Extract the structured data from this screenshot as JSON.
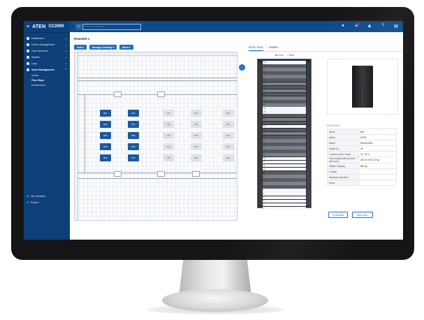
{
  "app": {
    "logo": "ATEN",
    "model": "CC2000",
    "search_placeholder": "Search Functions"
  },
  "sidebar": {
    "items": [
      {
        "label": "Dashboard",
        "icon": "grid-icon",
        "chev": "⌄"
      },
      {
        "label": "Device Management",
        "icon": "device-icon",
        "chev": "⌄"
      },
      {
        "label": "User Accounts",
        "icon": "user-icon",
        "chev": "⌄"
      },
      {
        "label": "System",
        "icon": "gear-icon",
        "chev": "⌄"
      },
      {
        "label": "Logs",
        "icon": "log-icon",
        "chev": "⌄"
      },
      {
        "label": "Asset Management",
        "icon": "asset-icon",
        "chev": "⌃"
      }
    ],
    "subitems": [
      "Assets",
      "Floor Maps",
      "Infrastructure"
    ],
    "favorites": "My Favorites",
    "recent": "Recent"
  },
  "main": {
    "room": "Room201 ▾",
    "toolbar": {
      "add": "Add ▾",
      "manage": "Manage Drawing ▾",
      "more": "More ▾"
    },
    "tabs": {
      "rack_view": "Rack View",
      "assets": "Assets"
    },
    "radios": {
      "front": "◉ Front",
      "rear": "○ Rear"
    },
    "racks": [
      {
        "label": "B01"
      },
      {
        "label": "B02"
      },
      {
        "label": "B03"
      },
      {
        "label": "B04"
      },
      {
        "label": "B05"
      },
      {
        "label": "B06"
      },
      {
        "label": "B07"
      },
      {
        "label": "B08"
      },
      {
        "label": "B09"
      },
      {
        "label": "B10"
      },
      {
        "label": "C01"
      },
      {
        "label": "C02"
      },
      {
        "label": "C03"
      },
      {
        "label": "C04"
      },
      {
        "label": "C05"
      },
      {
        "label": "D01"
      },
      {
        "label": "D02"
      },
      {
        "label": "D03"
      },
      {
        "label": "D04"
      },
      {
        "label": "D05"
      },
      {
        "label": "E01"
      },
      {
        "label": "E02"
      },
      {
        "label": "E03"
      },
      {
        "label": "E04"
      },
      {
        "label": "E05"
      }
    ],
    "spec_title": "RA42U1000",
    "spec": [
      {
        "k": "Name",
        "v": "B01"
      },
      {
        "k": "Maker",
        "v": "ATEN"
      },
      {
        "k": "Model",
        "v": "RA42U1000"
      },
      {
        "k": "Height (U)",
        "v": "42"
      },
      {
        "k": "In space (used / total)",
        "v": "21 / 42 U"
      },
      {
        "k": "Total Weight (without rack / with rack)",
        "v": "429.72 / 624.72 kg"
      },
      {
        "k": "Weight Capacity",
        "v": "800 kg"
      },
      {
        "k": "Contact",
        "v": ""
      },
      {
        "k": "Warranty expiration",
        "v": ""
      },
      {
        "k": "Notes",
        "v": ""
      }
    ],
    "actions": {
      "properties": "Properties",
      "view_spec": "View spec."
    }
  }
}
